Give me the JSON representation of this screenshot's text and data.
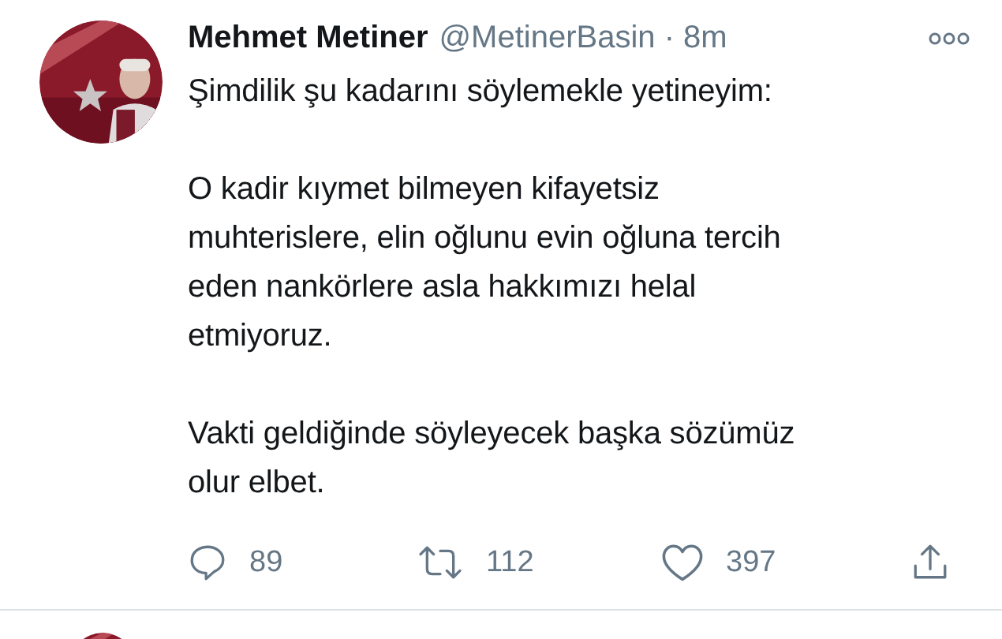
{
  "tweet": {
    "author": {
      "name": "Mehmet Metiner",
      "meta": "@MetinerBasin · 8m"
    },
    "paragraphs": [
      "Şimdilik şu kadarını söylemekle yetineyim:",
      "O kadir kıymet bilmeyen kifayetsiz\nmuhterislere, elin oğlunu evin oğluna tercih\neden nankörlere asla hakkımızı helal\netmiyoruz.",
      "Vakti geldiğinde söyleyecek başka sözümüz\nolur elbet."
    ],
    "actions": [
      {
        "kind": "reply",
        "count": "89"
      },
      {
        "kind": "retweet",
        "count": "112"
      },
      {
        "kind": "like",
        "count": "397"
      },
      {
        "kind": "share"
      }
    ]
  }
}
